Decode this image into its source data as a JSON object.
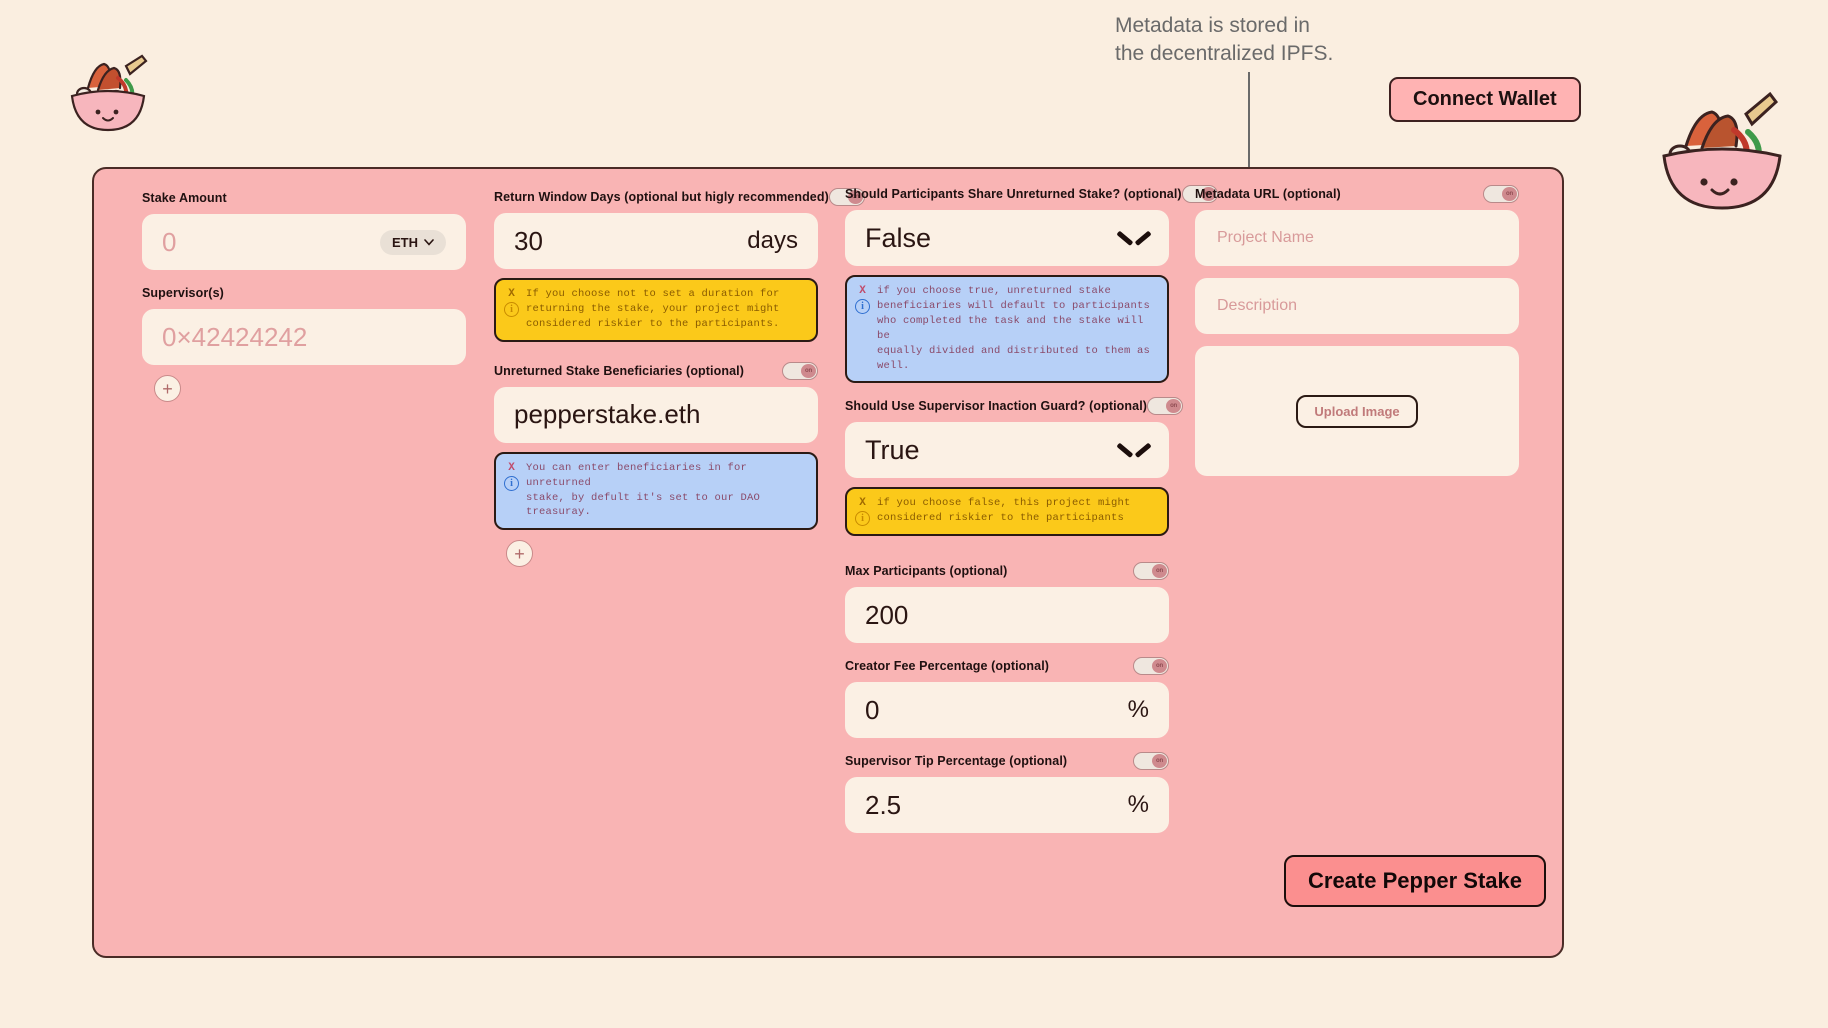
{
  "annotation": {
    "text": "Metadata is stored in\nthe decentralized  IPFS."
  },
  "header": {
    "connect_wallet_label": "Connect Wallet"
  },
  "colors": {
    "page_bg": "#faeee0",
    "panel_bg": "#f9b4b4",
    "input_bg": "#fbf0e4",
    "warn_bg": "#fbc91a",
    "info_bg": "#b7d0f7",
    "accent_button": "#fb8f8f",
    "connect_button": "#ffb3b3"
  },
  "form": {
    "stake_amount": {
      "label": "Stake Amount",
      "value": "0",
      "currency": "ETH",
      "currency_icon": "chevron-down-icon"
    },
    "supervisors": {
      "label": "Supervisor(s)",
      "placeholder": "0×42424242",
      "add_label": "+"
    },
    "return_window_days": {
      "label": "Return Window Days (optional but higly recommended)",
      "value": "30",
      "unit": "days",
      "toggle": "on",
      "callout": {
        "type": "warn",
        "x": "X",
        "icon": "info-circle-icon",
        "text": "If you choose not to set a duration for\nreturning the stake, your project might\nconsidered riskier to the participants."
      }
    },
    "unreturned_stake_beneficiaries": {
      "label": "Unreturned Stake Beneficiaries (optional)",
      "value": "pepperstake.eth",
      "toggle": "on",
      "add_label": "+",
      "callout": {
        "type": "info",
        "x": "X",
        "icon": "info-circle-icon",
        "text": "You can enter beneficiaries in for unreturned\nstake, by defult it's set to our DAO\ntreasuray."
      }
    },
    "share_unreturned_stake": {
      "label": "Should Participants Share Unreturned Stake? (optional)",
      "value": "False",
      "toggle": "on",
      "dropdown_icon": "chevron-down-icon",
      "callout": {
        "type": "info",
        "x": "X",
        "icon": "info-circle-icon",
        "text": "if you choose true, unreturned stake\nbeneficiaries will default to participants\nwho completed the task and the stake will be\nequally divided and distributed to them as\nwell."
      }
    },
    "supervisor_inaction_guard": {
      "label": "Should Use Supervisor Inaction Guard? (optional)",
      "value": "True",
      "toggle": "on",
      "dropdown_icon": "chevron-down-icon",
      "callout": {
        "type": "warn",
        "x": "X",
        "icon": "info-circle-icon",
        "text": "if you choose false, this project might\nconsidered riskier to the participants"
      }
    },
    "max_participants": {
      "label": "Max Participants (optional)",
      "value": "200",
      "toggle": "on"
    },
    "creator_fee_percentage": {
      "label": "Creator Fee Percentage (optional)",
      "value": "0",
      "unit": "%",
      "toggle": "on"
    },
    "supervisor_tip_percentage": {
      "label": "Supervisor Tip Percentage (optional)",
      "value": "2.5",
      "unit": "%",
      "toggle": "on"
    },
    "metadata": {
      "label": "Metadata URL (optional)",
      "toggle": "on",
      "project_name_placeholder": "Project Name",
      "description_placeholder": "Description",
      "upload_label": "Upload Image"
    }
  },
  "footer": {
    "create_label": "Create Pepper Stake"
  },
  "toggle_text": "on"
}
